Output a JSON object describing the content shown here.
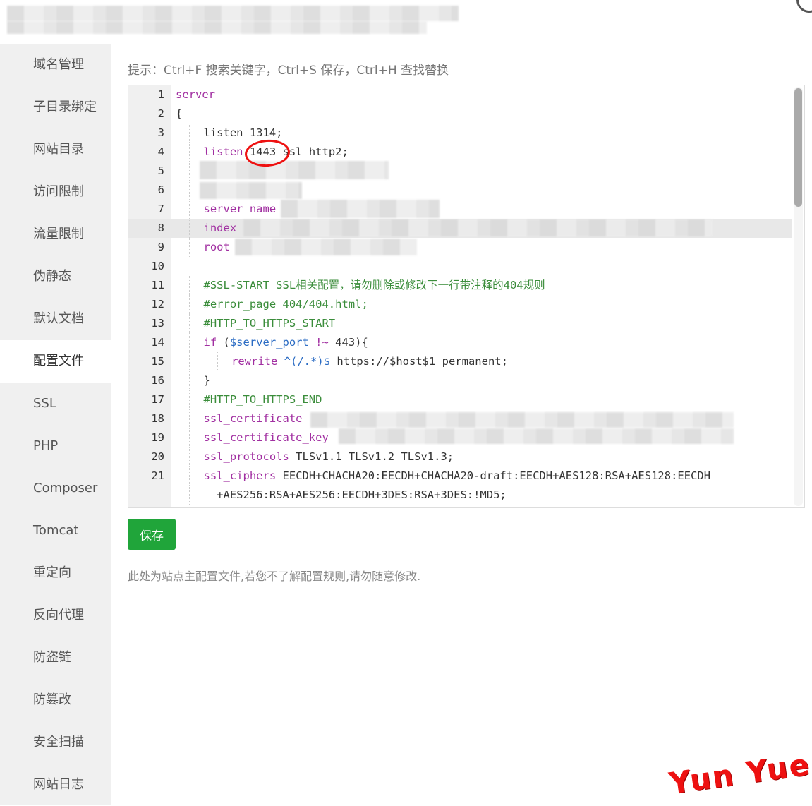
{
  "sidebar": {
    "items": [
      {
        "label": "域名管理",
        "active": false
      },
      {
        "label": "子目录绑定",
        "active": false
      },
      {
        "label": "网站目录",
        "active": false
      },
      {
        "label": "访问限制",
        "active": false
      },
      {
        "label": "流量限制",
        "active": false
      },
      {
        "label": "伪静态",
        "active": false
      },
      {
        "label": "默认文档",
        "active": false
      },
      {
        "label": "配置文件",
        "active": true
      },
      {
        "label": "SSL",
        "active": false
      },
      {
        "label": "PHP",
        "active": false
      },
      {
        "label": "Composer",
        "active": false
      },
      {
        "label": "Tomcat",
        "active": false
      },
      {
        "label": "重定向",
        "active": false
      },
      {
        "label": "反向代理",
        "active": false
      },
      {
        "label": "防盗链",
        "active": false
      },
      {
        "label": "防篡改",
        "active": false
      },
      {
        "label": "安全扫描",
        "active": false
      },
      {
        "label": "网站日志",
        "active": false
      }
    ]
  },
  "main": {
    "tip": "提示：Ctrl+F 搜索关键字，Ctrl+S 保存，Ctrl+H 查找替换",
    "save_label": "保存",
    "note": "此处为站点主配置文件,若您不了解配置规则,请勿随意修改."
  },
  "editor": {
    "lines": [
      {
        "n": "1",
        "indent": 0,
        "parts": [
          [
            "kw",
            "server"
          ]
        ]
      },
      {
        "n": "2",
        "indent": 0,
        "parts": [
          [
            "",
            "{"
          ]
        ]
      },
      {
        "n": "3",
        "indent": 1,
        "parts": [
          [
            "",
            "listen 1314;"
          ]
        ]
      },
      {
        "n": "4",
        "indent": 1,
        "parts": [
          [
            "kw",
            "listen"
          ],
          [
            "",
            " 1443 ssl http2;"
          ]
        ]
      },
      {
        "n": "5",
        "indent": 1,
        "parts": []
      },
      {
        "n": "6",
        "indent": 1,
        "parts": []
      },
      {
        "n": "7",
        "indent": 1,
        "parts": [
          [
            "kw",
            "server_name"
          ]
        ]
      },
      {
        "n": "8",
        "indent": 1,
        "parts": [
          [
            "kw",
            "index"
          ]
        ],
        "highlight": true
      },
      {
        "n": "9",
        "indent": 1,
        "parts": [
          [
            "kw",
            "root"
          ]
        ]
      },
      {
        "n": "10",
        "indent": 0,
        "parts": []
      },
      {
        "n": "11",
        "indent": 1,
        "parts": [
          [
            "cm",
            "#SSL-START SSL相关配置，请勿删除或修改下一行带注释的404规则"
          ]
        ]
      },
      {
        "n": "12",
        "indent": 1,
        "parts": [
          [
            "cm",
            "#error_page 404/404.html;"
          ]
        ]
      },
      {
        "n": "13",
        "indent": 1,
        "parts": [
          [
            "cm",
            "#HTTP_TO_HTTPS_START"
          ]
        ]
      },
      {
        "n": "14",
        "indent": 1,
        "parts": [
          [
            "kw",
            "if"
          ],
          [
            "",
            " ("
          ],
          [
            "vr",
            "$server_port"
          ],
          [
            "",
            " "
          ],
          [
            "kw",
            "!~"
          ],
          [
            "",
            " 443){"
          ]
        ]
      },
      {
        "n": "15",
        "indent": 2,
        "parts": [
          [
            "kw",
            "rewrite"
          ],
          [
            "",
            " "
          ],
          [
            "vr",
            "^(/.*)$"
          ],
          [
            "",
            " https://$host$1 permanent;"
          ]
        ]
      },
      {
        "n": "16",
        "indent": 1,
        "parts": [
          [
            "",
            "}"
          ]
        ]
      },
      {
        "n": "17",
        "indent": 1,
        "parts": [
          [
            "cm",
            "#HTTP_TO_HTTPS_END"
          ]
        ]
      },
      {
        "n": "18",
        "indent": 1,
        "parts": [
          [
            "kw",
            "ssl_certificate"
          ]
        ]
      },
      {
        "n": "19",
        "indent": 1,
        "parts": [
          [
            "kw",
            "ssl_certificate_key"
          ]
        ]
      },
      {
        "n": "20",
        "indent": 1,
        "parts": [
          [
            "kw",
            "ssl_protocols"
          ],
          [
            "",
            " TLSv1.1 TLSv1.2 TLSv1.3;"
          ]
        ]
      },
      {
        "n": "21",
        "indent": 1,
        "parts": [
          [
            "kw",
            "ssl_ciphers"
          ],
          [
            "",
            " EECDH+CHACHA20:EECDH+CHACHA20-draft:EECDH+AES128:RSA+AES128:EECDH"
          ]
        ]
      },
      {
        "n": "",
        "indent": 1,
        "wrap": true,
        "parts": [
          [
            "",
            "  +AES256:RSA+AES256:EECDH+3DES:RSA+3DES:!MD5;"
          ]
        ]
      }
    ]
  },
  "watermark": "Yun Yue",
  "colors": {
    "accent": "#20a53a",
    "keyword": "#a12fa1",
    "comment": "#3b8d3b",
    "variable": "#2b6cc4",
    "annotation": "#e11111"
  }
}
